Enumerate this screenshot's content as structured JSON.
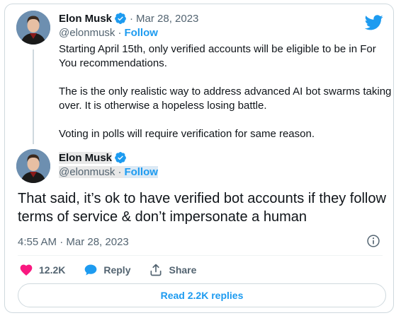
{
  "quoted_tweet": {
    "author_name": "Elon Musk",
    "handle": "@elonmusk",
    "follow_label": "Follow",
    "separator": "·",
    "date": "Mar 28, 2023",
    "text": "Starting April 15th, only verified accounts will be eligible to be in For You recommendations.\n\nThe is the only realistic way to address advanced AI bot swarms taking over. It is otherwise a hopeless losing battle.\n\nVoting in polls will require verification for same reason."
  },
  "main_tweet": {
    "author_name": "Elon Musk",
    "handle": "@elonmusk",
    "follow_label": "Follow",
    "separator": "·",
    "text": "That said, it’s ok to have verified bot accounts if they follow terms of service & don’t impersonate a human",
    "timestamp": "4:55 AM · Mar 28, 2023"
  },
  "actions": {
    "likes_count": "12.2K",
    "reply_label": "Reply",
    "share_label": "Share"
  },
  "read_replies_label": "Read 2.2K replies",
  "colors": {
    "accent": "#1d9bf0",
    "like": "#f91880",
    "muted": "#536471"
  },
  "icons": [
    "twitter-bird-icon",
    "verified-badge-icon",
    "heart-icon",
    "reply-bubble-icon",
    "share-icon",
    "info-icon"
  ]
}
